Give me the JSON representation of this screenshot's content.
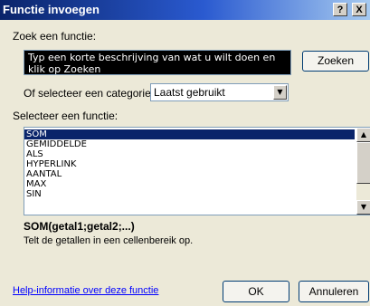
{
  "window": {
    "title": "Functie invoegen",
    "help_btn": "?",
    "close_btn": "X"
  },
  "search": {
    "label": "Zoek een functie:",
    "value": "Typ een korte beschrijving van wat u wilt doen en klik op Zoeken",
    "button_label": "Zoeken"
  },
  "category": {
    "label": "Of selecteer een categorie:",
    "selected": "Laatst gebruikt",
    "arrow_icon": "chevron-down-icon"
  },
  "function_list": {
    "label": "Selecteer een functie:",
    "items": [
      "SOM",
      "GEMIDDELDE",
      "ALS",
      "HYPERLINK",
      "AANTAL",
      "MAX",
      "SIN"
    ],
    "selected_index": 0
  },
  "details": {
    "syntax": "SOM(getal1;getal2;...)",
    "description": "Telt de getallen in een cellenbereik op."
  },
  "footer": {
    "help_link": "Help-informatie over deze functie",
    "ok_label": "OK",
    "cancel_label": "Annuleren"
  },
  "colors": {
    "title_bar_start": "#0a246a",
    "title_bar_end": "#a6caf0",
    "selection": "#0a246a",
    "dialog_bg": "#ece9d8",
    "link": "#0000ff"
  }
}
